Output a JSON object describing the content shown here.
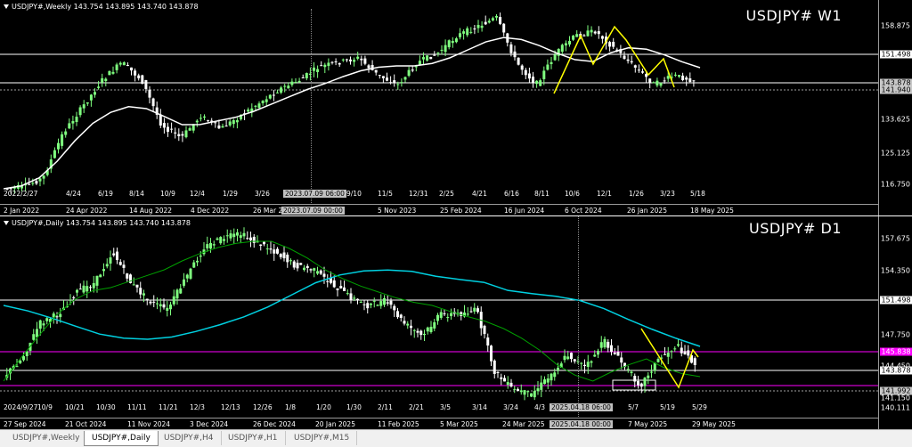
{
  "weekly": {
    "header": "USDJPY#,Weekly  143.754 143.895 143.740 143.878",
    "title": "USDJPY# W1",
    "price_ticks": [
      "158.875",
      "151.498",
      "143.878",
      "141.940",
      "133.625",
      "125.125",
      "116.750"
    ],
    "top_dates": [
      "2022/2/27",
      "4/24",
      "6/19",
      "8/14",
      "10/9",
      "12/4",
      "1/29",
      "3/26",
      "2023.07.09 06:00",
      "9/10",
      "11/5",
      "12/31",
      "2/25",
      "4/21",
      "6/16",
      "8/11",
      "10/6",
      "12/1",
      "1/26",
      "3/23",
      "5/18"
    ],
    "bottom_dates": [
      "2 Jan 2022",
      "24 Apr 2022",
      "14 Aug 2022",
      "4 Dec 2022",
      "26 Mar 2023",
      "2023.07.09 00:00",
      "5 Nov 2023",
      "25 Feb 2024",
      "16 Jun 2024",
      "6 Oct 2024",
      "26 Jan 2025",
      "18 May 2025"
    ]
  },
  "daily": {
    "header": "USDJPY#,Daily  143.754 143.895 143.740 143.878",
    "title": "USDJPY# D1",
    "price_ticks": [
      "157.675",
      "154.350",
      "151.498",
      "147.750",
      "145.838",
      "144.450",
      "143.878",
      "141.992",
      "141.150",
      "140.111"
    ],
    "top_dates": [
      "2024/9/27",
      "10/9",
      "10/21",
      "10/30",
      "11/11",
      "11/21",
      "12/3",
      "12/13",
      "12/26",
      "1/8",
      "1/20",
      "1/30",
      "2/11",
      "2/21",
      "3/5",
      "3/14",
      "3/24",
      "4/3",
      "2025.04.18 06:00",
      "5/7",
      "5/19",
      "5/29"
    ],
    "bottom_dates": [
      "27 Sep 2024",
      "21 Oct 2024",
      "11 Nov 2024",
      "3 Dec 2024",
      "26 Dec 2024",
      "20 Jan 2025",
      "11 Feb 2025",
      "5 Mar 2025",
      "24 Mar 2025",
      "2025.04.18 00:00",
      "7 May 2025",
      "29 May 2025"
    ]
  },
  "tabs": [
    "USDJPY#,Weekly",
    "USDJPY#,Daily",
    "USDJPY#,H4",
    "USDJPY#,H1",
    "USDJPY#,M15"
  ],
  "active_tab": "USDJPY#,Daily",
  "colors": {
    "bull": "#7fff7f",
    "bear": "#ffffff",
    "ma_slow_w": "#ffffff",
    "ma_fast_d": "#00a000",
    "ma_slow_d": "#00d0e0",
    "zigzag": "#ffff00",
    "magenta": "#ff00ff"
  }
}
